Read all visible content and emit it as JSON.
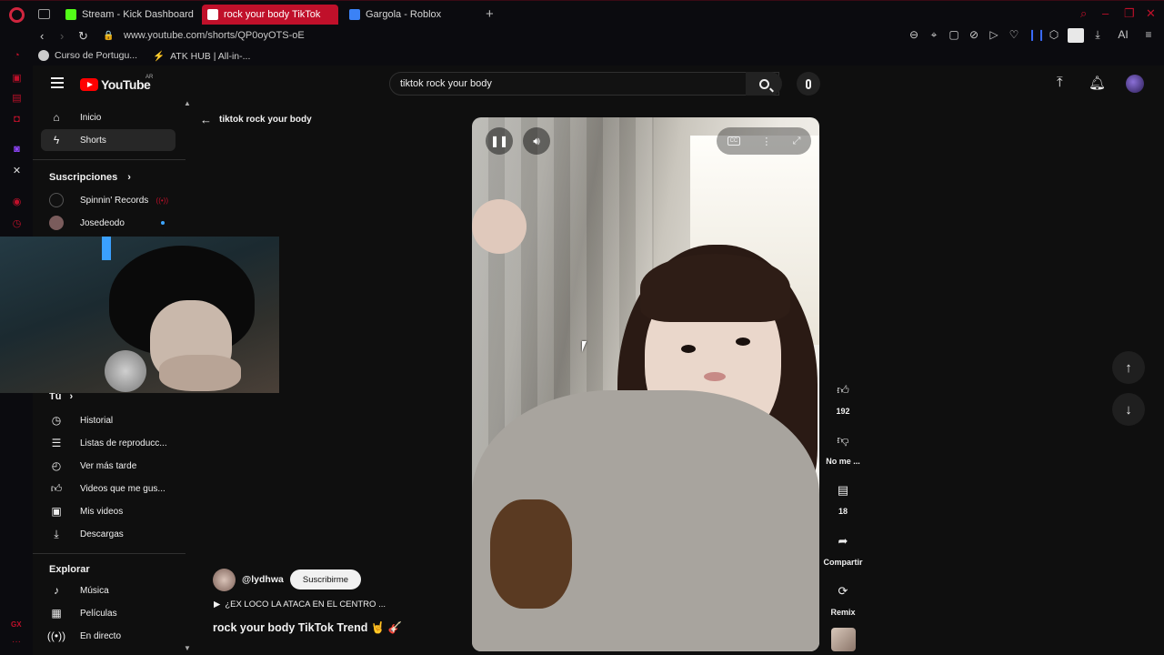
{
  "browser": {
    "tabs": [
      {
        "label": "Stream - Kick Dashboard",
        "fav_color": "#53fc18"
      },
      {
        "label": "rock your body TikTok",
        "fav_color": "#ff0000"
      },
      {
        "label": "Gargola - Roblox",
        "fav_color": "#3b82f6"
      }
    ],
    "new_tab": "+",
    "url": "www.youtube.com/shorts/QP0oyOTS-oE",
    "toolbar_ai": "AI",
    "bookmarks": [
      {
        "label": "Curso de Portugu..."
      },
      {
        "label": "ATK HUB | All-in-..."
      }
    ],
    "gx_label": "GX"
  },
  "youtube": {
    "logo_text": "YouTube",
    "country": "AR",
    "search_value": "tiktok rock your body",
    "sidebar": {
      "main": [
        {
          "label": "Inicio",
          "icon": "home-icon"
        },
        {
          "label": "Shorts",
          "icon": "shorts-icon"
        }
      ],
      "subscriptions_heading": "Suscripciones",
      "subscriptions": [
        {
          "label": "Spinnin' Records",
          "indicator": "live"
        },
        {
          "label": "Josedeodo",
          "indicator": "new"
        }
      ],
      "you_heading": "Tú",
      "you": [
        {
          "label": "Historial",
          "icon": "history-icon"
        },
        {
          "label": "Listas de reproducc...",
          "icon": "playlist-icon"
        },
        {
          "label": "Ver más tarde",
          "icon": "clock-icon"
        },
        {
          "label": "Videos que me gus...",
          "icon": "like-icon"
        },
        {
          "label": "Mis videos",
          "icon": "video-icon"
        },
        {
          "label": "Descargas",
          "icon": "download-icon"
        }
      ],
      "explore_heading": "Explorar",
      "explore": [
        {
          "label": "Música",
          "icon": "music-icon"
        },
        {
          "label": "Películas",
          "icon": "film-icon"
        },
        {
          "label": "En directo",
          "icon": "live-icon"
        }
      ]
    },
    "back_query": "tiktok rock your body",
    "short": {
      "channel_handle": "@lydhwa",
      "subscribe_label": "Suscribirme",
      "song": "¿EX LOCO LA ATACA EN EL CENTRO ...",
      "title": "rock your body TikTok Trend 🤘 🎸",
      "actions": {
        "likes": "192",
        "dislike_label": "No me ...",
        "comments": "18",
        "share_label": "Compartir",
        "remix_label": "Remix"
      }
    }
  }
}
